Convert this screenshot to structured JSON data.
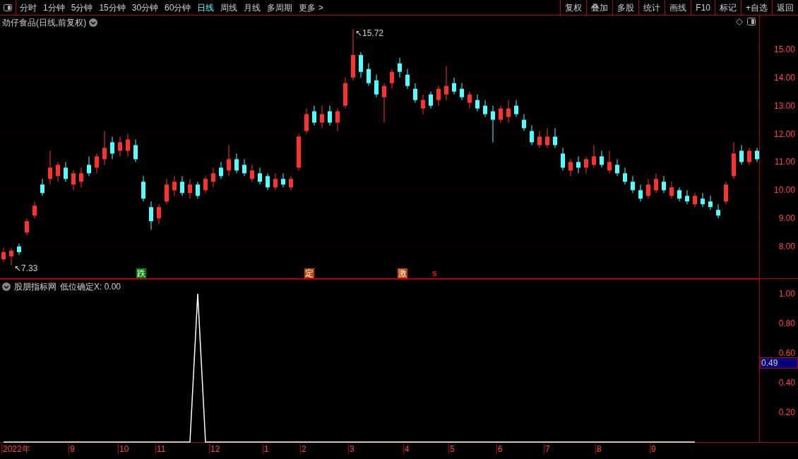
{
  "toolbar": {
    "periods": [
      {
        "label": "分时",
        "selected": false
      },
      {
        "label": "1分钟",
        "selected": false
      },
      {
        "label": "5分钟",
        "selected": false
      },
      {
        "label": "15分钟",
        "selected": false
      },
      {
        "label": "30分钟",
        "selected": false
      },
      {
        "label": "60分钟",
        "selected": false
      },
      {
        "label": "日线",
        "selected": true
      },
      {
        "label": "周线",
        "selected": false
      },
      {
        "label": "月线",
        "selected": false
      },
      {
        "label": "多周期",
        "selected": false
      },
      {
        "label": "更多 >",
        "selected": false
      }
    ],
    "buttons": [
      "复权",
      "叠加",
      "多股",
      "统计",
      "画线",
      "F10",
      "标记",
      "+自选",
      "返回"
    ]
  },
  "main_chart": {
    "title": "劲仔食品(日线,前复权)",
    "high_label": "↖15.72",
    "low_label": "↖7.33",
    "chart_data": {
      "type": "candlestick",
      "grid": true,
      "ylim": [
        6.85,
        16.2
      ],
      "yticks": [
        {
          "value": 15,
          "label": "15.00"
        },
        {
          "value": 14,
          "label": "14.00"
        },
        {
          "value": 13,
          "label": "13.00"
        },
        {
          "value": 12,
          "label": "12.00"
        },
        {
          "value": 11,
          "label": "11.00"
        },
        {
          "value": 10,
          "label": "10.00"
        },
        {
          "value": 9,
          "label": "9.00"
        },
        {
          "value": 8,
          "label": "8.00"
        }
      ],
      "ohlc": [
        [
          7.55,
          7.95,
          7.45,
          7.8
        ],
        [
          7.65,
          7.95,
          7.33,
          7.85
        ],
        [
          8.0,
          8.1,
          7.7,
          7.8
        ],
        [
          8.5,
          9.0,
          8.4,
          8.9
        ],
        [
          9.1,
          9.6,
          9.0,
          9.45
        ],
        [
          10.2,
          10.4,
          9.8,
          9.9
        ],
        [
          10.4,
          11.4,
          10.2,
          10.8
        ],
        [
          10.5,
          11.0,
          10.3,
          10.9
        ],
        [
          10.8,
          11.0,
          10.3,
          10.4
        ],
        [
          10.2,
          10.7,
          10.0,
          10.6
        ],
        [
          10.3,
          10.8,
          10.1,
          10.6
        ],
        [
          10.9,
          11.2,
          10.5,
          10.6
        ],
        [
          10.8,
          11.3,
          10.6,
          11.2
        ],
        [
          11.1,
          12.1,
          10.9,
          11.5
        ],
        [
          11.7,
          11.9,
          11.1,
          11.3
        ],
        [
          11.4,
          11.9,
          11.2,
          11.7
        ],
        [
          11.4,
          12.0,
          11.2,
          11.8
        ],
        [
          11.6,
          11.8,
          11.0,
          11.1
        ],
        [
          10.3,
          10.5,
          9.6,
          9.7
        ],
        [
          9.4,
          9.6,
          8.6,
          8.9
        ],
        [
          9.0,
          9.5,
          8.8,
          9.4
        ],
        [
          9.6,
          10.4,
          9.5,
          10.2
        ],
        [
          10.0,
          10.5,
          9.8,
          10.3
        ],
        [
          10.3,
          10.5,
          9.8,
          9.9
        ],
        [
          9.9,
          10.4,
          9.7,
          10.2
        ],
        [
          10.2,
          10.3,
          9.7,
          9.8
        ],
        [
          10.0,
          10.5,
          9.9,
          10.4
        ],
        [
          10.3,
          10.8,
          10.1,
          10.6
        ],
        [
          10.8,
          11.0,
          10.4,
          10.5
        ],
        [
          10.7,
          11.6,
          10.5,
          11.1
        ],
        [
          11.1,
          11.3,
          10.6,
          10.7
        ],
        [
          10.9,
          11.1,
          10.5,
          10.6
        ],
        [
          10.4,
          10.9,
          10.3,
          10.7
        ],
        [
          10.6,
          10.8,
          10.2,
          10.3
        ],
        [
          10.5,
          10.6,
          10.0,
          10.1
        ],
        [
          10.1,
          10.6,
          10.0,
          10.4
        ],
        [
          10.4,
          10.6,
          10.1,
          10.2
        ],
        [
          10.1,
          10.5,
          10.0,
          10.4
        ],
        [
          10.8,
          12.0,
          10.7,
          11.9
        ],
        [
          12.1,
          12.9,
          12.0,
          12.7
        ],
        [
          12.8,
          13.0,
          12.3,
          12.4
        ],
        [
          12.4,
          13.0,
          12.2,
          12.7
        ],
        [
          12.8,
          13.0,
          12.3,
          12.4
        ],
        [
          12.4,
          12.9,
          12.1,
          12.8
        ],
        [
          13.0,
          14.0,
          12.9,
          13.8
        ],
        [
          14.0,
          15.72,
          13.9,
          14.8
        ],
        [
          14.8,
          14.9,
          14.0,
          14.2
        ],
        [
          14.3,
          14.5,
          13.7,
          13.8
        ],
        [
          13.9,
          14.1,
          13.3,
          13.4
        ],
        [
          13.3,
          13.8,
          12.4,
          13.7
        ],
        [
          13.8,
          14.3,
          13.6,
          14.2
        ],
        [
          14.5,
          14.7,
          14.0,
          14.2
        ],
        [
          14.1,
          14.3,
          13.6,
          13.7
        ],
        [
          13.6,
          13.8,
          13.1,
          13.2
        ],
        [
          12.9,
          13.4,
          12.7,
          13.2
        ],
        [
          13.4,
          13.5,
          12.9,
          13.0
        ],
        [
          13.2,
          13.7,
          13.0,
          13.6
        ],
        [
          13.4,
          14.4,
          13.2,
          13.7
        ],
        [
          13.8,
          14.0,
          13.4,
          13.5
        ],
        [
          13.6,
          13.8,
          13.2,
          13.3
        ],
        [
          13.1,
          13.5,
          12.9,
          13.4
        ],
        [
          13.2,
          13.4,
          12.8,
          12.9
        ],
        [
          13.0,
          13.2,
          12.6,
          12.7
        ],
        [
          12.8,
          13.0,
          11.7,
          12.5
        ],
        [
          12.5,
          13.0,
          12.4,
          12.9
        ],
        [
          12.6,
          13.2,
          12.4,
          12.9
        ],
        [
          13.0,
          13.2,
          12.6,
          12.7
        ],
        [
          12.5,
          12.7,
          12.1,
          12.2
        ],
        [
          12.1,
          12.3,
          11.6,
          11.7
        ],
        [
          11.6,
          12.1,
          11.5,
          11.9
        ],
        [
          11.6,
          12.2,
          11.5,
          11.9
        ],
        [
          11.9,
          12.2,
          11.5,
          11.6
        ],
        [
          11.3,
          11.5,
          10.7,
          10.8
        ],
        [
          10.7,
          11.1,
          10.5,
          11.0
        ],
        [
          11.0,
          11.2,
          10.6,
          10.8
        ],
        [
          10.8,
          11.2,
          10.6,
          11.1
        ],
        [
          10.9,
          11.6,
          10.8,
          11.2
        ],
        [
          11.2,
          11.4,
          10.8,
          10.9
        ],
        [
          10.7,
          11.4,
          10.6,
          11.0
        ],
        [
          10.9,
          11.1,
          10.5,
          10.6
        ],
        [
          10.6,
          10.8,
          10.2,
          10.3
        ],
        [
          10.3,
          10.5,
          9.9,
          10.0
        ],
        [
          10.0,
          10.2,
          9.6,
          9.7
        ],
        [
          9.8,
          10.4,
          9.7,
          10.2
        ],
        [
          10.0,
          10.6,
          9.9,
          10.4
        ],
        [
          10.3,
          10.5,
          9.9,
          10.0
        ],
        [
          9.8,
          10.3,
          9.7,
          10.1
        ],
        [
          10.0,
          10.1,
          9.6,
          9.7
        ],
        [
          9.8,
          10.0,
          9.5,
          9.6
        ],
        [
          9.5,
          9.9,
          9.4,
          9.8
        ],
        [
          9.7,
          9.9,
          9.4,
          9.5
        ],
        [
          9.6,
          9.8,
          9.3,
          9.4
        ],
        [
          9.3,
          9.5,
          9.0,
          9.1
        ],
        [
          9.6,
          10.3,
          9.5,
          10.2
        ],
        [
          10.5,
          11.7,
          10.4,
          11.3
        ],
        [
          11.4,
          11.6,
          10.9,
          11.0
        ],
        [
          11.0,
          11.5,
          10.9,
          11.4
        ],
        [
          11.4,
          11.5,
          11.0,
          11.1
        ]
      ]
    },
    "signals": [
      {
        "text": "跌",
        "color": "#008000",
        "kind": "box"
      },
      {
        "text": "定",
        "color": "#c04000",
        "kind": "box"
      },
      {
        "text": "激",
        "color": "#c04000",
        "kind": "box"
      },
      {
        "text": "s",
        "color": "#ff0000",
        "kind": "letter"
      }
    ]
  },
  "indicator": {
    "name": "股朋指标网",
    "reading": "低位确定X: 0.00",
    "current_value": "0.49",
    "chart_data": {
      "type": "line",
      "ylim": [
        0,
        1.1
      ],
      "yticks": [
        {
          "value": 1,
          "label": "1.00"
        },
        {
          "value": 0.8,
          "label": "0.80"
        },
        {
          "value": 0.6,
          "label": "0.60"
        },
        {
          "value": 0.4,
          "label": "0.40"
        },
        {
          "value": 0.2,
          "label": "0.20"
        }
      ],
      "series": [
        {
          "color": "#ffffff",
          "values": [
            0,
            0,
            0,
            0,
            0,
            0,
            0,
            0,
            0,
            0,
            0,
            0,
            0,
            0,
            0,
            0,
            0,
            0,
            0,
            0,
            0,
            0,
            0,
            0,
            0,
            1,
            0,
            0,
            0,
            0,
            0,
            0,
            0,
            0,
            0,
            0,
            0,
            0,
            0,
            0,
            0,
            0,
            0,
            0,
            0,
            0,
            0,
            0,
            0,
            0,
            0,
            0,
            0,
            0,
            0,
            0,
            0,
            0,
            0,
            0,
            0,
            0,
            0,
            0,
            0,
            0,
            0,
            0,
            0,
            0,
            0,
            0,
            0,
            0,
            0,
            0,
            0,
            0,
            0,
            0,
            0,
            0,
            0,
            0,
            0,
            0,
            0,
            0,
            0,
            0
          ]
        }
      ]
    }
  },
  "date_axis": [
    "2022年",
    "9",
    "10",
    "11",
    "12",
    "1",
    "2",
    "3",
    "4",
    "5",
    "6",
    "7",
    "8",
    "9"
  ]
}
